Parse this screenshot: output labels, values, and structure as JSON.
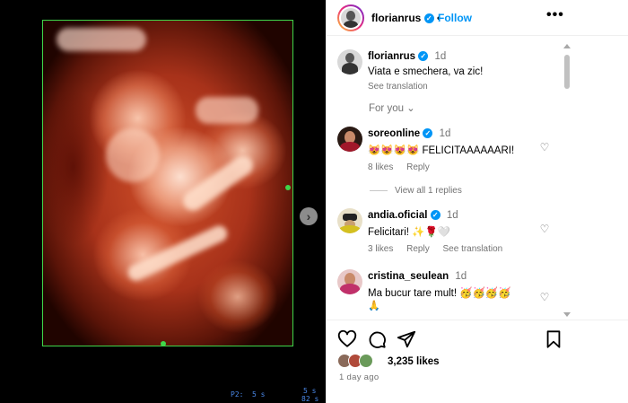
{
  "media": {
    "overlay_p2": "P2:",
    "overlay_5s": "5 s",
    "overlay_right_top": "5 s",
    "overlay_right_bottom": "82 s"
  },
  "header": {
    "username": "florianrus",
    "follow_label": "Follow",
    "more_label": "•••"
  },
  "caption": {
    "username": "florianrus",
    "time": "1d",
    "text": "Viata e smechera, va zic!",
    "see_translation": "See translation"
  },
  "for_you_label": "For you ⌄",
  "comments": [
    {
      "username": "soreonline",
      "verified": true,
      "time": "1d",
      "text": "😻😻😻😻 FELICITAAAAAARI!",
      "likes": "8 likes",
      "reply": "Reply",
      "view_replies": "View all 1 replies"
    },
    {
      "username": "andia.oficial",
      "verified": true,
      "time": "1d",
      "text": "Felicitari! ✨🌹🤍",
      "likes": "3 likes",
      "reply": "Reply",
      "see_translation": "See translation"
    },
    {
      "username": "cristina_seulean",
      "verified": false,
      "time": "1d",
      "text": "Ma bucur tare mult! 🥳🥳🥳🥳",
      "extra": "🙏"
    }
  ],
  "actions": {
    "likes_count": "3,235 likes",
    "posted_ago": "1 day ago"
  },
  "colors": {
    "accent": "#0095f6",
    "muted": "#737373",
    "frame_green": "#3fd64a"
  }
}
